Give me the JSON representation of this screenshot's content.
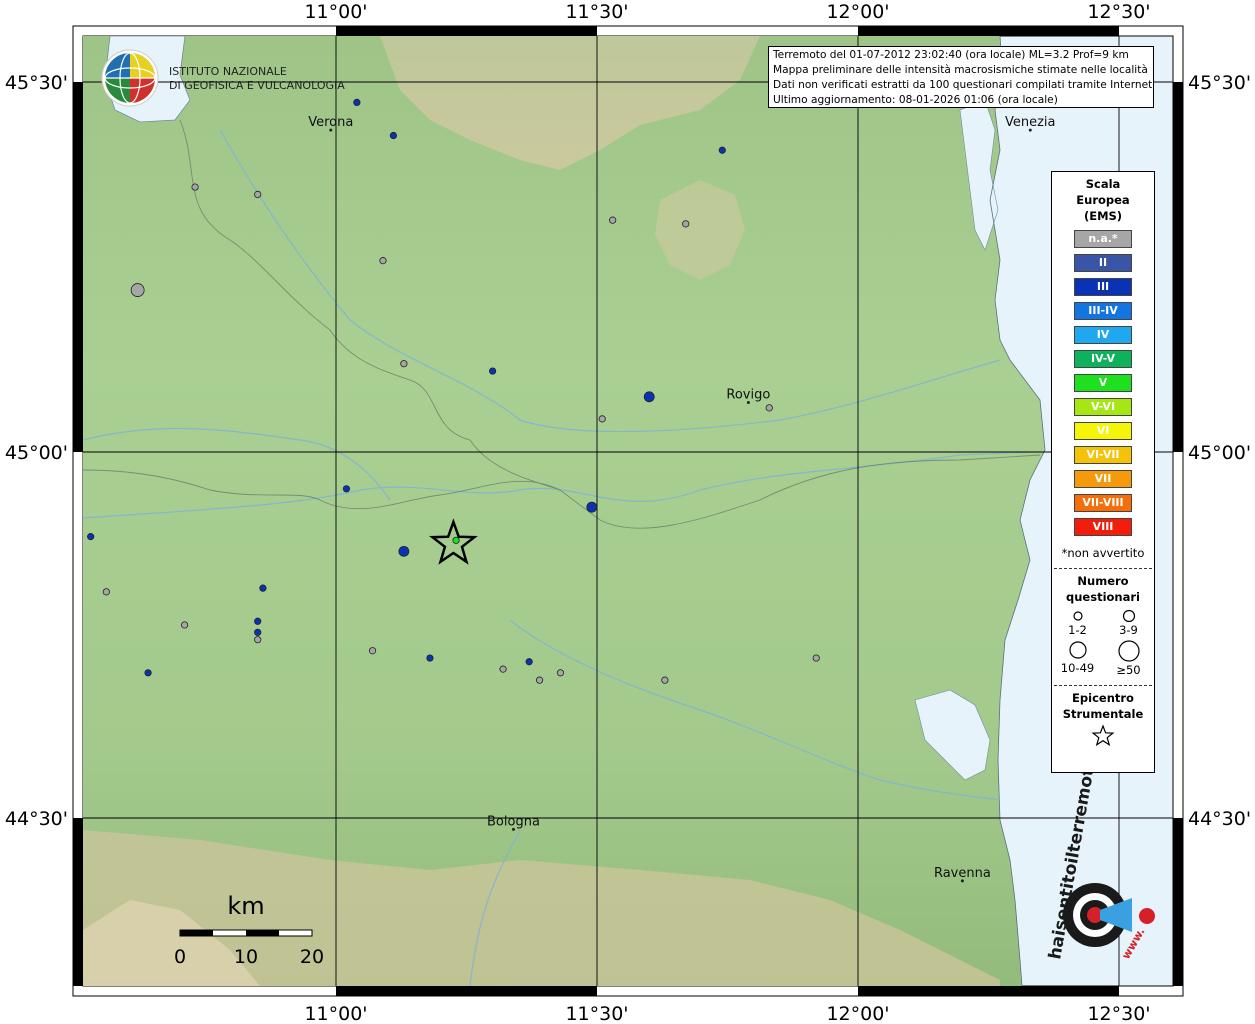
{
  "header": {
    "lines": [
      "Terremoto del 01-07-2012 23:02:40 (ora locale) ML=3.2 Prof=9 km",
      "Mappa preliminare delle intensità macrosismiche stimate nelle località",
      "Dati non verificati estratti da 100 questionari compilati tramite Internet.",
      "Ultimo aggiornamento: 08-01-2026 01:06 (ora locale)"
    ]
  },
  "axes": {
    "lon_labels": [
      "11°00'",
      "11°30'",
      "12°00'",
      "12°30'"
    ],
    "lat_labels": [
      "45°30'",
      "45°00'",
      "44°30'"
    ]
  },
  "institute": {
    "line1": "ISTITUTO NAZIONALE",
    "line2": "DI GEOFISICA E VULCANOLOGIA"
  },
  "cities": [
    {
      "name": "Verona",
      "lon": 10.99,
      "lat": 45.44
    },
    {
      "name": "Venezia",
      "lon": 12.33,
      "lat": 45.44
    },
    {
      "name": "Rovigo",
      "lon": 11.79,
      "lat": 45.07
    },
    {
      "name": "Bologna",
      "lon": 11.34,
      "lat": 44.49
    },
    {
      "name": "Ravenna",
      "lon": 12.2,
      "lat": 44.42
    }
  ],
  "epicenter": {
    "lon": 11.225,
    "lat": 44.875
  },
  "points": [
    {
      "lon": 11.04,
      "lat": 45.475,
      "class": "III",
      "size": 1
    },
    {
      "lon": 11.11,
      "lat": 45.43,
      "class": "III",
      "size": 1
    },
    {
      "lon": 11.53,
      "lat": 45.315,
      "class": "na",
      "size": 1
    },
    {
      "lon": 11.67,
      "lat": 45.31,
      "class": "na",
      "size": 1
    },
    {
      "lon": 11.74,
      "lat": 45.41,
      "class": "III",
      "size": 1
    },
    {
      "lon": 10.73,
      "lat": 45.36,
      "class": "na",
      "size": 1
    },
    {
      "lon": 10.85,
      "lat": 45.35,
      "class": "na",
      "size": 1
    },
    {
      "lon": 11.09,
      "lat": 45.26,
      "class": "na",
      "size": 1
    },
    {
      "lon": 10.62,
      "lat": 45.22,
      "class": "na",
      "size": 3
    },
    {
      "lon": 11.13,
      "lat": 45.12,
      "class": "na",
      "size": 1
    },
    {
      "lon": 11.3,
      "lat": 45.11,
      "class": "III",
      "size": 1
    },
    {
      "lon": 11.83,
      "lat": 45.06,
      "class": "na",
      "size": 1
    },
    {
      "lon": 11.51,
      "lat": 45.045,
      "class": "na",
      "size": 1
    },
    {
      "lon": 11.6,
      "lat": 45.075,
      "class": "III",
      "size": 2
    },
    {
      "lon": 11.02,
      "lat": 44.95,
      "class": "III",
      "size": 1
    },
    {
      "lon": 11.13,
      "lat": 44.865,
      "class": "III",
      "size": 2
    },
    {
      "lon": 11.49,
      "lat": 44.925,
      "class": "III",
      "size": 2
    },
    {
      "lon": 11.23,
      "lat": 44.88,
      "class": "V",
      "size": 1
    },
    {
      "lon": 10.53,
      "lat": 44.885,
      "class": "III",
      "size": 1
    },
    {
      "lon": 10.56,
      "lat": 44.81,
      "class": "na",
      "size": 1
    },
    {
      "lon": 10.86,
      "lat": 44.815,
      "class": "III",
      "size": 1
    },
    {
      "lon": 10.85,
      "lat": 44.745,
      "class": "na",
      "size": 1
    },
    {
      "lon": 10.85,
      "lat": 44.77,
      "class": "III",
      "size": 1
    },
    {
      "lon": 10.64,
      "lat": 44.7,
      "class": "III",
      "size": 1
    },
    {
      "lon": 10.71,
      "lat": 44.765,
      "class": "na",
      "size": 1
    },
    {
      "lon": 10.85,
      "lat": 44.755,
      "class": "III",
      "size": 1
    },
    {
      "lon": 11.07,
      "lat": 44.73,
      "class": "na",
      "size": 1
    },
    {
      "lon": 11.18,
      "lat": 44.72,
      "class": "III",
      "size": 1
    },
    {
      "lon": 11.32,
      "lat": 44.705,
      "class": "na",
      "size": 1
    },
    {
      "lon": 11.37,
      "lat": 44.715,
      "class": "III",
      "size": 1
    },
    {
      "lon": 11.43,
      "lat": 44.7,
      "class": "na",
      "size": 1
    },
    {
      "lon": 11.63,
      "lat": 44.69,
      "class": "na",
      "size": 1
    },
    {
      "lon": 11.39,
      "lat": 44.69,
      "class": "na",
      "size": 1
    },
    {
      "lon": 11.92,
      "lat": 44.72,
      "class": "na",
      "size": 1
    }
  ],
  "legend": {
    "scale_title": [
      "Scala",
      "Europea",
      "(EMS)"
    ],
    "classes": [
      {
        "label": "n.a.*",
        "color": "#a6a6a6"
      },
      {
        "label": "II",
        "color": "#3a54a7"
      },
      {
        "label": "III",
        "color": "#0a32b4"
      },
      {
        "label": "III-IV",
        "color": "#1575e0"
      },
      {
        "label": "IV",
        "color": "#1fa8f0"
      },
      {
        "label": "IV-V",
        "color": "#0fb25c"
      },
      {
        "label": "V",
        "color": "#1ee01e"
      },
      {
        "label": "V-VI",
        "color": "#a6e614"
      },
      {
        "label": "VI",
        "color": "#f5f50a"
      },
      {
        "label": "VI-VII",
        "color": "#f5c20a"
      },
      {
        "label": "VII",
        "color": "#f59a0a"
      },
      {
        "label": "VII-VIII",
        "color": "#f56e0a"
      },
      {
        "label": "VIII",
        "color": "#f01e0a"
      }
    ],
    "note": "*non avvertito",
    "count_title": [
      "Numero",
      "questionari"
    ],
    "sizes": [
      "1-2",
      "3-9",
      "10-49",
      "≥50"
    ],
    "epi_title": [
      "Epicentro",
      "Strumentale"
    ]
  },
  "scalebar": {
    "unit": "km",
    "ticks": [
      "0",
      "10",
      "20"
    ]
  },
  "site_logo": "haisentitoilterremoto.it",
  "site_logo_url": "www."
}
